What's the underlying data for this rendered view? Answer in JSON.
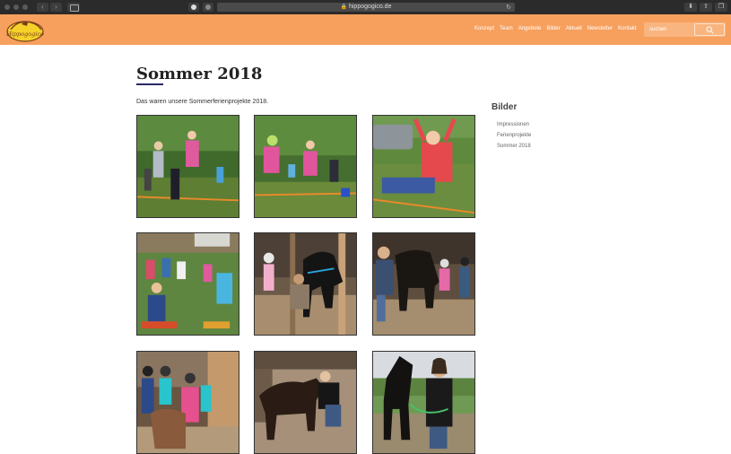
{
  "browser": {
    "url": "hippogogico.de"
  },
  "header": {
    "logo_text": "Hippogogico",
    "nav": [
      "Konzept",
      "Team",
      "Angebote",
      "Bilder",
      "Aktuell",
      "Newsletter",
      "Kontakt"
    ],
    "search_placeholder": "suchen"
  },
  "main": {
    "title": "Sommer 2018",
    "intro": "Das waren unsere Sommerferienprojekte 2018.",
    "photos": [
      {
        "name": "photo-slackline-1"
      },
      {
        "name": "photo-slackline-2"
      },
      {
        "name": "photo-slackline-3"
      },
      {
        "name": "photo-group-meadow"
      },
      {
        "name": "photo-stable-horse-1"
      },
      {
        "name": "photo-stable-horse-2"
      },
      {
        "name": "photo-pony-children"
      },
      {
        "name": "photo-stable-horse-3"
      },
      {
        "name": "photo-horse-lead"
      }
    ]
  },
  "sidebar": {
    "title": "Bilder",
    "items": [
      "Impressionen",
      "Ferienprojekte",
      "Sommer 2018"
    ]
  },
  "colors": {
    "header": "#f7a05e",
    "underline": "#2a2a66"
  }
}
